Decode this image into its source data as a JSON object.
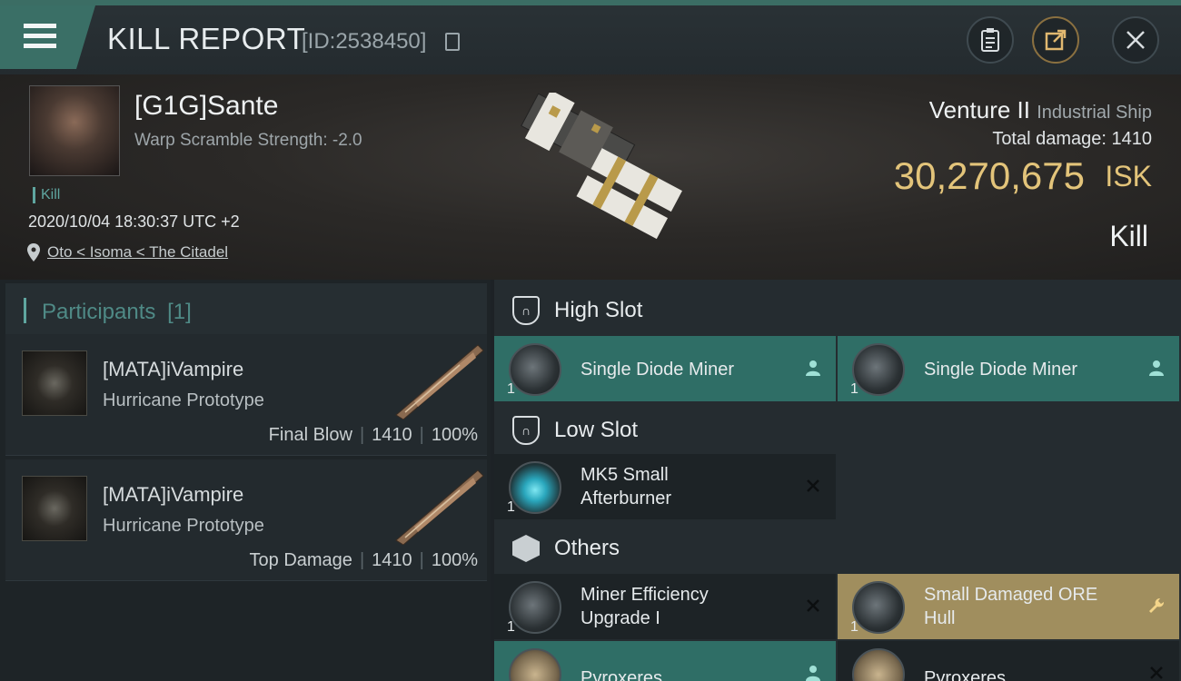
{
  "header": {
    "title": "KILL REPORT",
    "kill_id": "[ID:2538450]"
  },
  "victim": {
    "name": "[G1G]Sante",
    "warp_scramble": "Warp Scramble Strength: -2.0",
    "tag": "Kill",
    "datetime": "2020/10/04 18:30:37 UTC +2",
    "location": "Oto < Isoma < The Citadel",
    "ship_name": "Venture II",
    "ship_class": "Industrial Ship",
    "total_damage": "Total damage: 1410",
    "isk_value": "30,270,675",
    "isk_unit": "ISK",
    "result": "Kill"
  },
  "participants": {
    "label": "Participants",
    "count": "[1]",
    "rows": [
      {
        "name": "[MATA]iVampire",
        "ship": "Hurricane Prototype",
        "role": "Final Blow",
        "damage": "1410",
        "percent": "100%"
      },
      {
        "name": "[MATA]iVampire",
        "ship": "Hurricane Prototype",
        "role": "Top Damage",
        "damage": "1410",
        "percent": "100%"
      }
    ]
  },
  "fitting": {
    "high_slot_label": "High Slot",
    "low_slot_label": "Low Slot",
    "others_label": "Others",
    "high": [
      {
        "qty": "1",
        "name": "Single Diode Miner",
        "status": "dropped"
      },
      {
        "qty": "1",
        "name": "Single Diode Miner",
        "status": "dropped"
      }
    ],
    "low": [
      {
        "qty": "1",
        "name_line1": "MK5 Small",
        "name_line2": "Afterburner",
        "status": "destroyed"
      }
    ],
    "others": [
      {
        "qty": "1",
        "name_line1": "Miner Efficiency",
        "name_line2": "Upgrade I",
        "status": "destroyed"
      },
      {
        "qty": "1",
        "name_line1": "Small Damaged ORE",
        "name_line2": "Hull",
        "status": "salvage"
      },
      {
        "qty": "",
        "name": "Pyroxeres",
        "status": "dropped"
      },
      {
        "qty": "",
        "name": "Pyroxeres",
        "status": "destroyed"
      }
    ]
  },
  "colors": {
    "accent": "#3a6f66",
    "isk": "#e3c47a",
    "dropped_bg": "#2f6e66",
    "salvage_bg": "#a08e5e"
  }
}
